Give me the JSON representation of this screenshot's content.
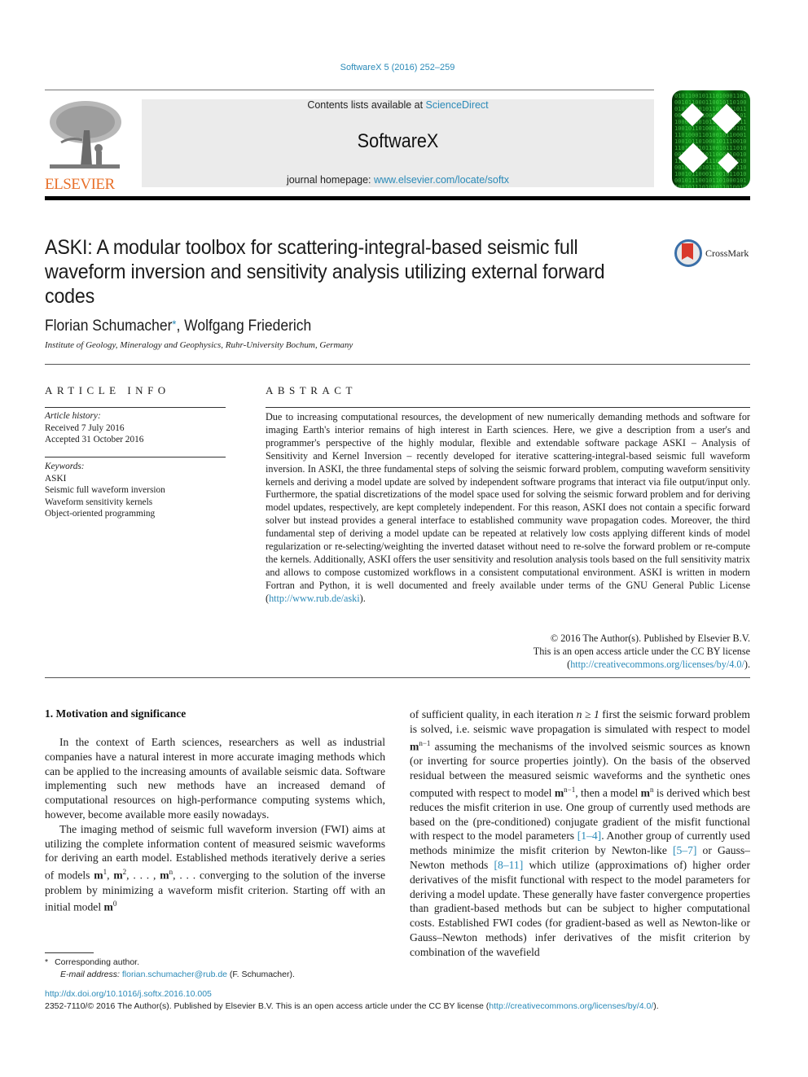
{
  "header": {
    "journal_ref": "SoftwareX 5 (2016) 252–259",
    "contents_prefix": "Contents lists available at ",
    "contents_link": "ScienceDirect",
    "journal_name": "SoftwareX",
    "homepage_prefix": "journal homepage: ",
    "homepage_link": "www.elsevier.com/locate/softx",
    "publisher_logo": "ELSEVIER",
    "crossmark_label": "CrossMark"
  },
  "article": {
    "title": "ASKI: A modular toolbox for scattering-integral-based seismic full waveform inversion and sensitivity analysis utilizing external forward codes",
    "authors": [
      {
        "name": "Florian Schumacher",
        "mark": "*"
      },
      {
        "name": "Wolfgang Friederich",
        "mark": ""
      }
    ],
    "author_sep": ", ",
    "affiliation": "Institute of Geology, Mineralogy and Geophysics, Ruhr-University Bochum, Germany"
  },
  "article_info": {
    "heading": "ARTICLE INFO",
    "history_label": "Article history:",
    "received": "Received 7 July 2016",
    "accepted": "Accepted 31 October 2016",
    "keywords_label": "Keywords:",
    "keywords": [
      "ASKI",
      "Seismic full waveform inversion",
      "Waveform sensitivity kernels",
      "Object-oriented programming"
    ]
  },
  "abstract": {
    "heading": "ABSTRACT",
    "text": "Due to increasing computational resources, the development of new numerically demanding methods and software for imaging Earth's interior remains of high interest in Earth sciences. Here, we give a description from a user's and programmer's perspective of the highly modular, flexible and extendable software package ASKI – Analysis of Sensitivity and Kernel Inversion – recently developed for iterative scattering-integral-based seismic full waveform inversion. In ASKI, the three fundamental steps of solving the seismic forward problem, computing waveform sensitivity kernels and deriving a model update are solved by independent software programs that interact via file output/input only. Furthermore, the spatial discretizations of the model space used for solving the seismic forward problem and for deriving model updates, respectively, are kept completely independent. For this reason, ASKI does not contain a specific forward solver but instead provides a general interface to established community wave propagation codes. Moreover, the third fundamental step of deriving a model update can be repeated at relatively low costs applying different kinds of model regularization or re-selecting/weighting the inverted dataset without need to re-solve the forward problem or re-compute the kernels. Additionally, ASKI offers the user sensitivity and resolution analysis tools based on the full sensitivity matrix and allows to compose customized workflows in a consistent computational environment. ASKI is written in modern Fortran and Python, it is well documented and freely available under terms of the GNU General Public License ",
    "url_open": "(",
    "url": "http://www.rub.de/aski",
    "url_close": ").",
    "copyright_line1": "© 2016 The Author(s). Published by Elsevier B.V.",
    "copyright_line2": "This is an open access article under the CC BY license",
    "license_open": "(",
    "license_url": "http://creativecommons.org/licenses/by/4.0/",
    "license_close": ")."
  },
  "section1": {
    "heading": "1.  Motivation and significance",
    "p1": "In the context of Earth sciences, researchers as well as industrial companies have a natural interest in more accurate imaging methods which can be applied to the increasing amounts of available seismic data. Software implementing such new methods have an increased demand of computational resources on high-performance computing systems which, however, become available more easily nowadays.",
    "p2_a": "The imaging method of seismic full waveform inversion (FWI) aims at utilizing the complete information content of measured seismic waveforms for deriving an earth model. Established methods iteratively derive a series of models ",
    "p2_b": " con­verging to the solution of the inverse problem by minimizing a waveform misfit criterion. Starting off with an initial model ",
    "r1": "of sufficient quality, in each iteration ",
    "r2": " first the seismic forward problem is solved, i.e. seismic wave propagation is simulated with respect to model ",
    "r3": " assuming the mechanisms of the involved seismic sources as known (or inverting for source properties jointly). On the basis of the observed residual between the measured seismic waveforms and the synthetic ones computed with respect to model ",
    "r4": ", then a model ",
    "r5": " is derived which best reduces the misfit criterion in use. One group of currently used methods are based on the (pre-conditioned) conjugate gradient of the misfit functional with respect to the model parameters ",
    "ref1": "[1–4]",
    "r6": ". Another group of currently used methods minimize the misfit criterion by Newton-like ",
    "ref2": "[5–7]",
    "r7": " or Gauss–Newton methods ",
    "ref3": "[8–11]",
    "r8": " which utilize (approximations of) higher order derivatives of the misfit functional with respect to the model parameters for deriving a model update. These generally have faster convergence properties than gradient-based methods but can be subject to higher computational costs. Established FWI codes (for gradient-based as well as Newton-like or Gauss–Newton methods) infer derivatives of the misfit criterion by combination of the wavefield",
    "math": {
      "m": "m",
      "sup1": "1",
      "sup2": "2",
      "supn": "n",
      "sup0": "0",
      "supn1": "n−1",
      "seq_sep": ", ",
      "ellipsis": ", . . . , ",
      "tail": ", . . .",
      "iter_cond": "n ≥ 1"
    }
  },
  "footnote": {
    "star": "*",
    "corresponding": "Corresponding author.",
    "email_label": "E-mail address:",
    "email": "florian.schumacher@rub.de",
    "email_suffix": " (F. Schumacher)."
  },
  "footer": {
    "doi": "http://dx.doi.org/10.1016/j.softx.2016.10.005",
    "issn_text": "2352-7110/© 2016 The Author(s). Published by Elsevier B.V. This is an open access article under the CC BY license (",
    "license_url": "http://creativecommons.org/licenses/by/4.0/",
    "issn_close": ")."
  },
  "colors": {
    "link": "#2a8ab8",
    "elsevier_orange": "#e8702a",
    "banner_bg": "#ebebeb",
    "cover_green": "#0b8a14"
  }
}
